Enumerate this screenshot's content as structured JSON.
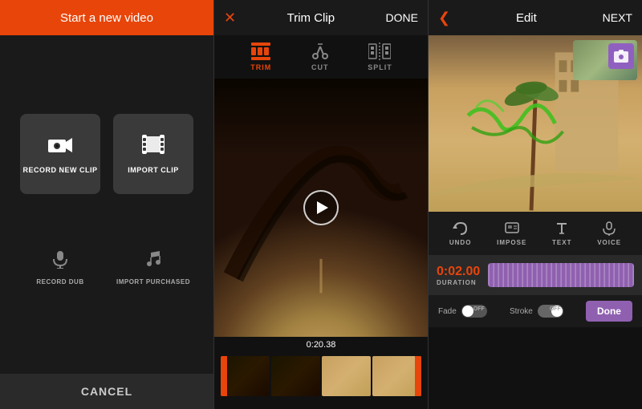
{
  "panel1": {
    "title": "Start a new video",
    "record_btn": "RECORD NEW CLIP",
    "import_btn": "IMPORT CLIP",
    "record_dub_btn": "RECORD DUB",
    "import_purchased_btn": "IMPORT PURCHASED",
    "cancel_btn": "CANCEL",
    "record_icon": "🎥",
    "import_icon": "🎞",
    "dub_icon": "🎙",
    "purchased_icon": "🎵"
  },
  "panel2": {
    "title": "Trim Clip",
    "done_btn": "DONE",
    "tools": [
      {
        "label": "TRIM",
        "active": true
      },
      {
        "label": "CUT",
        "active": false
      },
      {
        "label": "SPLIT",
        "active": false
      }
    ],
    "time_label": "0:20.38"
  },
  "panel3": {
    "title": "Edit",
    "next_btn": "NEXT",
    "tools": [
      {
        "label": "UNDO"
      },
      {
        "label": "IMPOSE"
      },
      {
        "label": "TEXT"
      },
      {
        "label": "VOICE"
      }
    ],
    "duration_time": "0:02.00",
    "duration_label": "DURATION",
    "fade_label": "Fade",
    "fade_toggle": "OFF",
    "stroke_label": "Stroke",
    "stroke_toggle": "OFF",
    "done_btn": "Done"
  }
}
